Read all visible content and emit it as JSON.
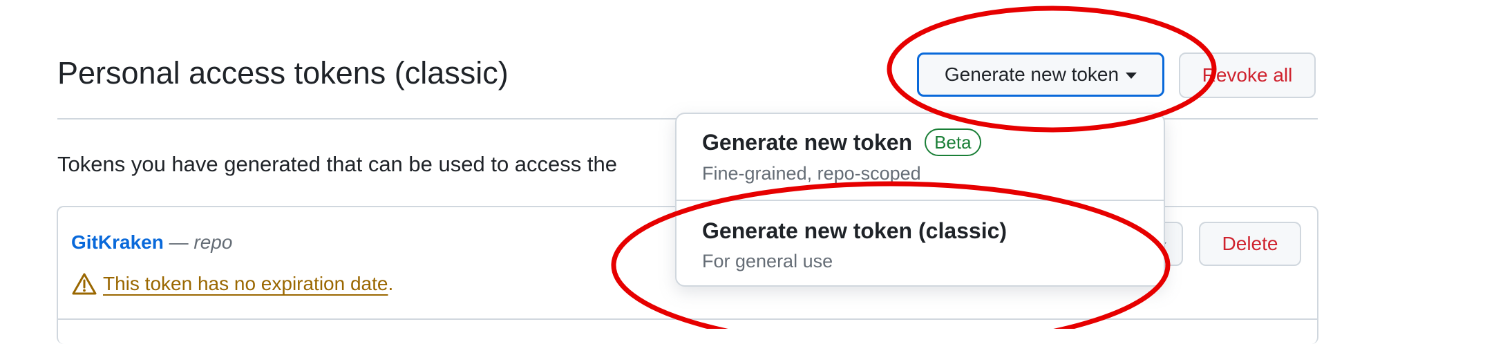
{
  "header": {
    "title": "Personal access tokens (classic)",
    "generate_label": "Generate new token",
    "revoke_label": "Revoke all"
  },
  "description": "Tokens you have generated that can be used to access the",
  "token": {
    "name": "GitKraken",
    "dash": " — ",
    "scope": "repo",
    "warning": "This token has no expiration date",
    "warning_period": ".",
    "delete_label": "Delete"
  },
  "menu": {
    "items": [
      {
        "title": "Generate new token",
        "badge": "Beta",
        "description": "Fine-grained, repo-scoped"
      },
      {
        "title": "Generate new token (classic)",
        "description": "For general use"
      }
    ]
  },
  "colors": {
    "accent": "#0969da",
    "danger": "#cf222e",
    "success": "#1a7f37",
    "warning": "#9a6700",
    "annotation": "#e60000"
  }
}
